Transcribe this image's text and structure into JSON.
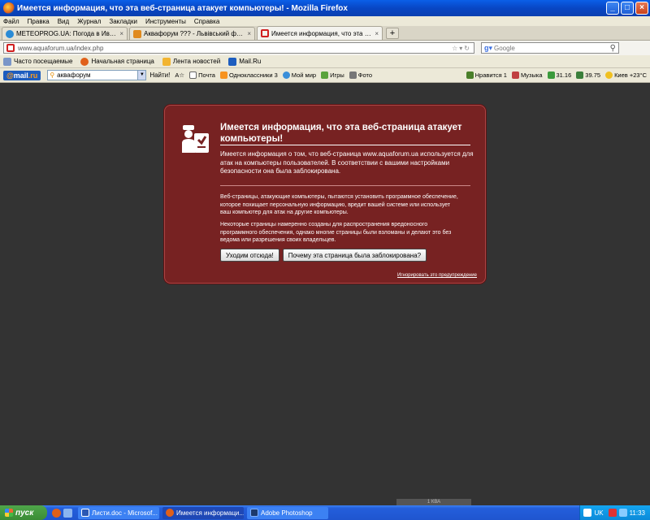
{
  "window": {
    "title": "Имеется информация, что эта веб-страница атакует компьютеры! - Mozilla Firefox"
  },
  "menu": [
    "Файл",
    "Правка",
    "Вид",
    "Журнал",
    "Закладки",
    "Инструменты",
    "Справка"
  ],
  "tabs": [
    {
      "label": "METEOPROG.UA: Погода в Ивано-Фран..."
    },
    {
      "label": "Аквафорум ??? - Львівський форум акв..."
    },
    {
      "label": "Имеется информация, что эта веб-стра..."
    }
  ],
  "newtab_label": "+",
  "nav": {
    "url": "www.aquaforum.ua/index.php",
    "search_placeholder": "Google"
  },
  "bookmarks": [
    "Часто посещаемые",
    "Начальная страница",
    "Лента новостей",
    "Mail.Ru"
  ],
  "mailru": {
    "logo_at": "@",
    "logo_main": "mail",
    "logo_suffix": ".ru",
    "search_value": "аквафорум",
    "find_label": "Найти!",
    "items": [
      {
        "label": "Почта"
      },
      {
        "label": "Одноклассники 3"
      },
      {
        "label": "Мой мир"
      },
      {
        "label": "Игры"
      },
      {
        "label": "Фото"
      }
    ],
    "right_items": [
      {
        "label": "Нравится 1"
      },
      {
        "label": "Музыка"
      },
      {
        "label": "31.16"
      },
      {
        "label": "39.75"
      },
      {
        "label": "Киев +23°C"
      }
    ]
  },
  "error": {
    "title": "Имеется информация, что эта веб-страница атакует компьютеры!",
    "summary": "Имеется информация о том, что веб-страница www.aquaforum.ua используется для атак на компьютеры пользователей. В соответствии с вашими настройками безопасности она была заблокирована.",
    "paragraph1": "Веб-страницы, атакующие компьютеры, пытаются установить программное обеспечение, которое похищает персональную информацию, вредит вашей системе или использует ваш компьютер для атак на другие компьютеры.",
    "paragraph2": "Некоторые страницы намеренно созданы для распространения вредоносного программного обеспечения, однако многие страницы были взломаны и делают это без ведома или разрешения своих владельцев.",
    "leave_button": "Уходим отсюда!",
    "why_button": "Почему эта страница была заблокирована?",
    "ignore_link": "Игнорировать это предупреждение"
  },
  "scroll_label": "1 КВА",
  "taskbar": {
    "start_label": "пуск",
    "tasks": [
      {
        "label": "Листи.doc - Microsof..."
      },
      {
        "label": "Имеется информаци..."
      },
      {
        "label": "Adobe Photoshop"
      }
    ],
    "lang": "UK",
    "clock": "11:33"
  },
  "colors": {
    "error_bg": "#772222",
    "page_bg": "#333333",
    "taskbar": "#245edb",
    "titlebar": "#0846c4"
  }
}
